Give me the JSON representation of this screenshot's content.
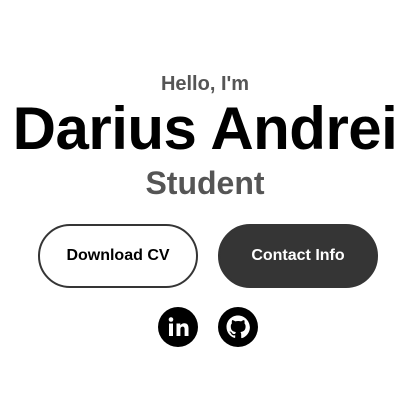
{
  "profile": {
    "greeting": "Hello, I'm",
    "name": "Darius Andrei",
    "role": "Student"
  },
  "buttons": {
    "download_cv": "Download CV",
    "contact_info": "Contact Info"
  },
  "social": {
    "icons": [
      "linkedin-icon",
      "github-icon"
    ]
  },
  "colors": {
    "primary_text": "#000000",
    "secondary_text": "#555555",
    "button_dark": "#353535",
    "background": "#ffffff"
  }
}
